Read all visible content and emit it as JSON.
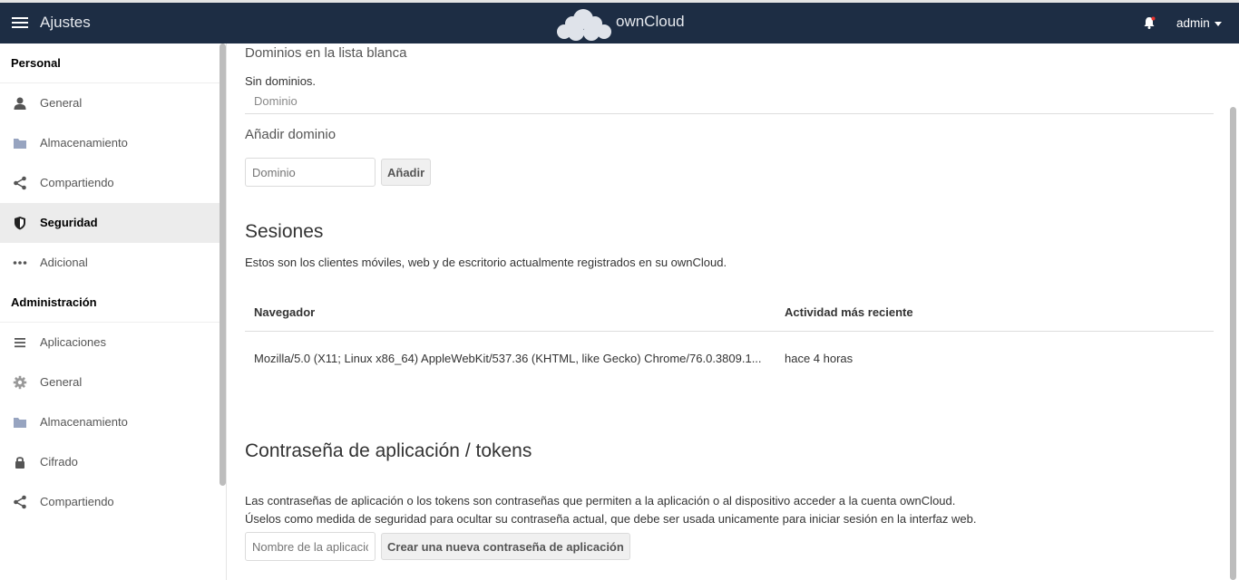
{
  "header": {
    "app_title": "Ajustes",
    "brand": "ownCloud",
    "user": "admin"
  },
  "sidebar": {
    "personal_title": "Personal",
    "personal_items": [
      {
        "label": "General",
        "icon": "user-icon"
      },
      {
        "label": "Almacenamiento",
        "icon": "folder-icon"
      },
      {
        "label": "Compartiendo",
        "icon": "share-icon"
      },
      {
        "label": "Seguridad",
        "icon": "shield-icon",
        "active": true
      },
      {
        "label": "Adicional",
        "icon": "more-icon"
      }
    ],
    "admin_title": "Administración",
    "admin_items": [
      {
        "label": "Aplicaciones",
        "icon": "list-icon"
      },
      {
        "label": "General",
        "icon": "gear-icon"
      },
      {
        "label": "Almacenamiento",
        "icon": "folder-icon"
      },
      {
        "label": "Cifrado",
        "icon": "lock-icon"
      },
      {
        "label": "Compartiendo",
        "icon": "share-icon"
      }
    ]
  },
  "domains": {
    "heading": "Dominios en la lista blanca",
    "empty": "Sin dominios.",
    "column": "Dominio",
    "add_heading": "Añadir dominio",
    "input_placeholder": "Dominio",
    "add_button": "Añadir"
  },
  "sessions": {
    "title": "Sesiones",
    "description": "Estos son los clientes móviles, web y de escritorio actualmente registrados en su ownCloud.",
    "col_browser": "Navegador",
    "col_activity": "Actividad más reciente",
    "rows": [
      {
        "browser": "Mozilla/5.0 (X11; Linux x86_64) AppleWebKit/537.36 (KHTML, like Gecko) Chrome/76.0.3809.1...",
        "activity": "hace 4 horas"
      }
    ]
  },
  "tokens": {
    "title": "Contraseña de aplicación / tokens",
    "desc1": "Las contraseñas de aplicación o los tokens son contraseñas que permiten a la aplicación o al dispositivo acceder a la cuenta ownCloud.",
    "desc2": "Úselos como medida de seguridad para ocultar su contraseña actual, que debe ser usada unicamente para iniciar sesión en la interfaz web.",
    "input_placeholder": "Nombre de la aplicación",
    "create_button": "Crear una nueva contraseña de aplicación"
  }
}
